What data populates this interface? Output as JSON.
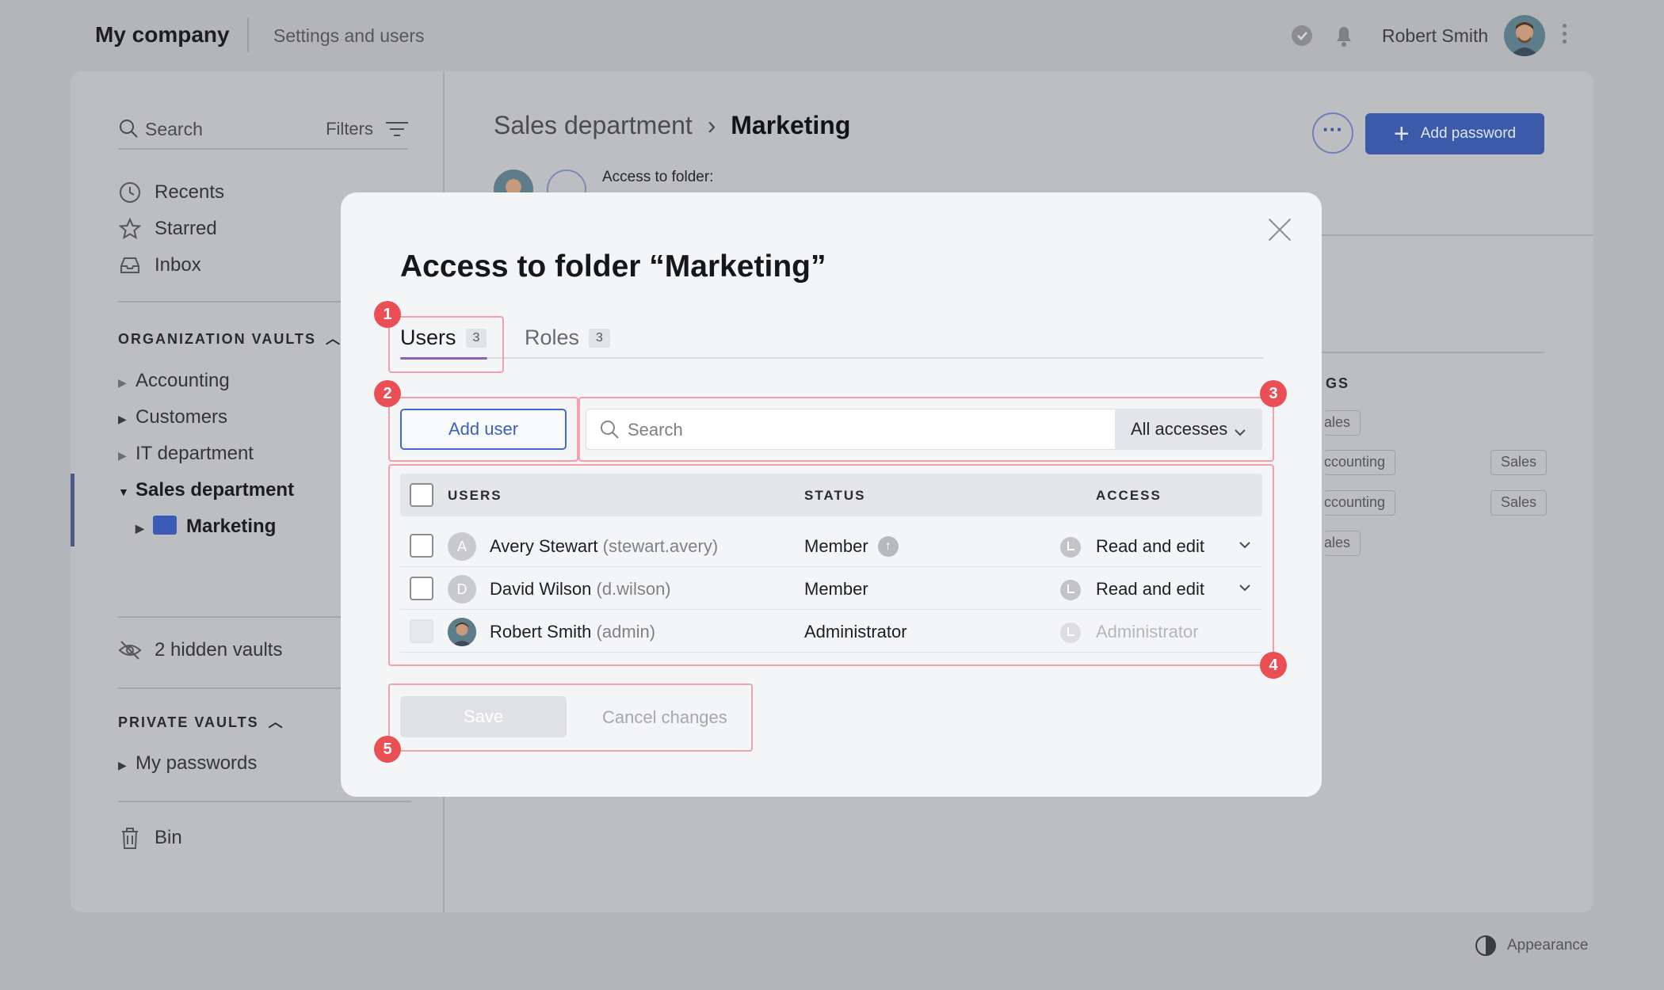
{
  "header": {
    "company": "My company",
    "section": "Settings and users",
    "user_name": "Robert Smith"
  },
  "sidebar": {
    "search_placeholder": "Search",
    "filters_label": "Filters",
    "quick": [
      {
        "label": "Recents",
        "icon": "clock-icon"
      },
      {
        "label": "Starred",
        "icon": "star-icon"
      },
      {
        "label": "Inbox",
        "icon": "inbox-icon"
      }
    ],
    "org_vaults_title": "ORGANIZATION VAULTS",
    "org_vaults": [
      {
        "label": "Accounting"
      },
      {
        "label": "Customers"
      },
      {
        "label": "IT department"
      },
      {
        "label": "Sales department"
      }
    ],
    "sub_folder": "Marketing",
    "hidden_vaults": "2 hidden vaults",
    "private_vaults_title": "PRIVATE VAULTS",
    "private_vaults": [
      {
        "label": "My passwords"
      }
    ],
    "bin": "Bin"
  },
  "content": {
    "breadcrumb_parent": "Sales department",
    "breadcrumb_current": "Marketing",
    "add_password": "Add password",
    "access_label": "Access to folder:",
    "tags_head": "GS",
    "tags": [
      "ales",
      "ccounting",
      "Sales",
      "ccounting",
      "Sales",
      "ales"
    ]
  },
  "appearance": "Appearance",
  "modal": {
    "title": "Access to folder “Marketing”",
    "tabs": [
      {
        "label": "Users",
        "count": "3"
      },
      {
        "label": "Roles",
        "count": "3"
      }
    ],
    "add_user": "Add user",
    "search_placeholder": "Search",
    "access_filter": "All accesses",
    "columns": {
      "users": "USERS",
      "status": "STATUS",
      "access": "ACCESS"
    },
    "rows": [
      {
        "initial": "A",
        "name": "Avery Stewart",
        "login": "(stewart.avery)",
        "status": "Member",
        "access": "Read and edit"
      },
      {
        "initial": "D",
        "name": "David Wilson",
        "login": "(d.wilson)",
        "status": "Member",
        "access": "Read and edit"
      },
      {
        "initial": "",
        "name": "Robert Smith",
        "login": "(admin)",
        "status": "Administrator",
        "access": "Administrator"
      }
    ],
    "save": "Save",
    "cancel": "Cancel changes",
    "badges": [
      "1",
      "2",
      "3",
      "4",
      "5"
    ],
    "colors": {
      "accent": "#3b5aa9",
      "badge": "#ea4f56",
      "highlight": "#f2a0a9",
      "tab_underline": "#8c63b0"
    }
  }
}
